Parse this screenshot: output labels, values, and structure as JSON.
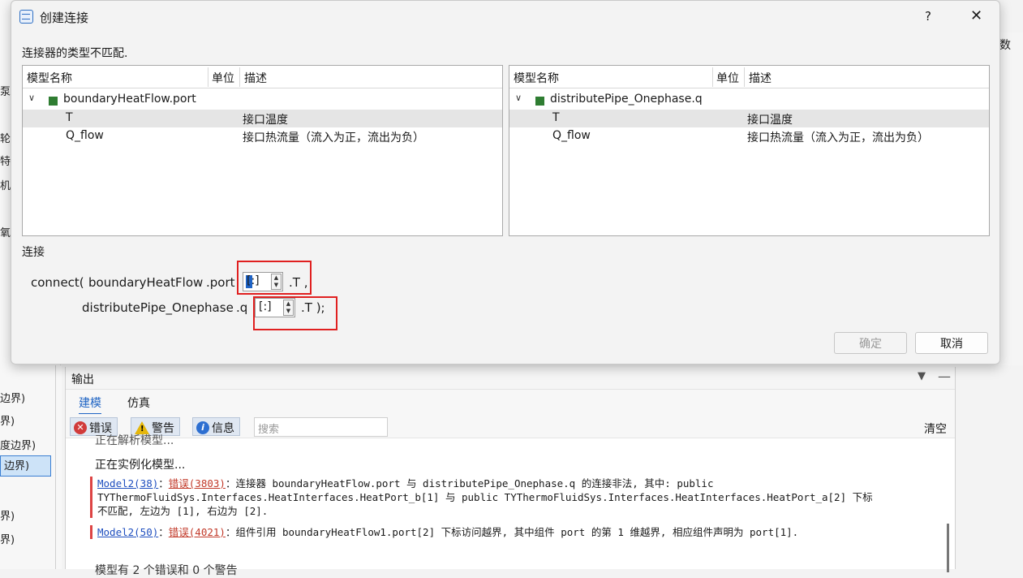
{
  "background": {
    "left_fragments": [
      "泵",
      "轮",
      "特",
      "机)",
      "氧",
      "边界)",
      "界)",
      "度边界)",
      "边界)",
      "界)",
      "界)"
    ],
    "right_fragment": "数"
  },
  "dialog": {
    "title": "创建连接",
    "help": "?",
    "close": "✕",
    "notice": "连接器的类型不匹配.",
    "left_tree": {
      "headers": [
        "模型名称",
        "单位",
        "描述"
      ],
      "root": "boundaryHeatFlow.port",
      "rows": [
        {
          "name": "T",
          "unit": "",
          "desc": "接口温度"
        },
        {
          "name": "Q_flow",
          "unit": "",
          "desc": "接口热流量（流入为正，流出为负）"
        }
      ]
    },
    "right_tree": {
      "headers": [
        "模型名称",
        "单位",
        "描述"
      ],
      "root": "distributePipe_Onephase.q",
      "rows": [
        {
          "name": "T",
          "unit": "",
          "desc": "接口温度"
        },
        {
          "name": "Q_flow",
          "unit": "",
          "desc": "接口热流量（流入为正，流出为负）"
        }
      ]
    },
    "connect_label": "连接",
    "line1": {
      "prefix": "connect(",
      "component": "boundaryHeatFlow",
      "port": ".port",
      "index": "[:]",
      "suffix": ".T ,"
    },
    "line2": {
      "component": "distributePipe_Onephase",
      "port": ".q",
      "index": "[:]",
      "suffix": ".T );"
    },
    "ok": "确定",
    "cancel": "取消"
  },
  "output": {
    "title": "输出",
    "tabs": [
      "建模",
      "仿真"
    ],
    "filters": {
      "error": "错误",
      "warning": "警告",
      "info": "信息"
    },
    "search_placeholder": "搜索",
    "clear": "清空",
    "lines": {
      "partial_top": "正在解析模型...",
      "instantiating": "正在实例化模型...",
      "bottom_partial": "模型有 2 个错误和 0 个警告"
    },
    "msg1": {
      "link": "Model2(38)",
      "sep": "：",
      "err": "错误(3803)",
      "text1": "：连接器 boundaryHeatFlow.port 与 distributePipe_Onephase.q 的连接非法, 其中: public",
      "text2": "TYThermoFluidSys.Interfaces.HeatInterfaces.HeatPort_b[1] 与 public TYThermoFluidSys.Interfaces.HeatInterfaces.HeatPort_a[2] 下标",
      "text3": "不匹配, 左边为 [1], 右边为 [2]."
    },
    "msg2": {
      "link": "Model2(50)",
      "sep": "：",
      "err": "错误(4021)",
      "text": "：组件引用 boundaryHeatFlow1.port[2] 下标访问越界, 其中组件 port 的第 1 维越界, 相应组件声明为 port[1]."
    }
  }
}
